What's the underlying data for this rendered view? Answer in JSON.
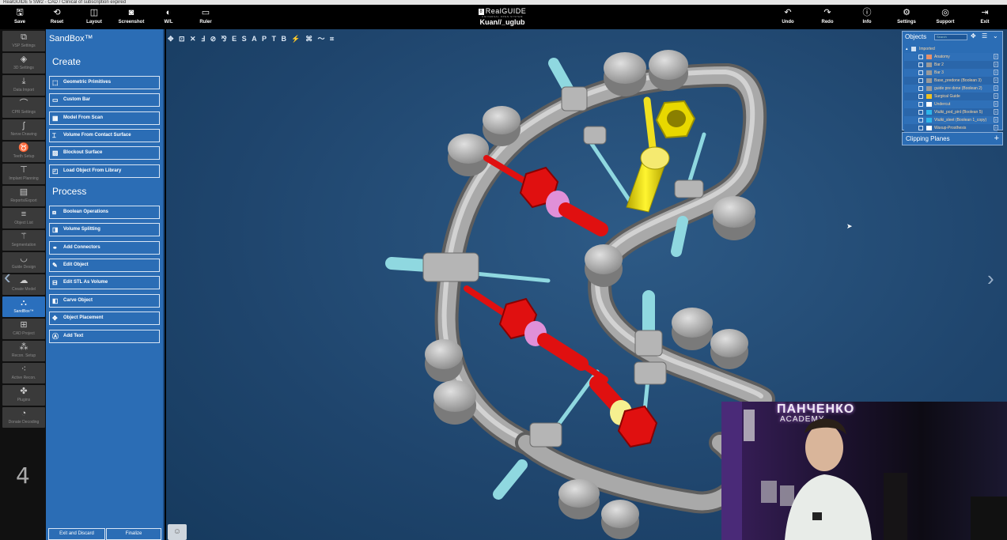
{
  "window": {
    "title": "RealGUIDE 5 SW2 - CAD / Clinical of subscription expired"
  },
  "toolbar": {
    "left": [
      {
        "icon": "save-icon",
        "label": "Save"
      },
      {
        "icon": "reset-icon",
        "label": "Reset"
      },
      {
        "icon": "layout-icon",
        "label": "Layout"
      },
      {
        "icon": "camera-icon",
        "label": "Screenshot"
      },
      {
        "icon": "contrast-icon",
        "label": "W/L"
      },
      {
        "icon": "ruler-icon",
        "label": "Ruler"
      }
    ],
    "right": [
      {
        "icon": "undo-icon",
        "label": "Undo"
      },
      {
        "icon": "redo-icon",
        "label": "Redo"
      },
      {
        "icon": "info-icon",
        "label": "Info"
      },
      {
        "icon": "gear-icon",
        "label": "Settings"
      },
      {
        "icon": "globe-icon",
        "label": "Support"
      },
      {
        "icon": "exit-icon",
        "label": "Exit"
      }
    ],
    "brand": "RealGUIDE",
    "brand_mark": "8",
    "brand_sub": "UNIVERSAL OPEN SYSTEM",
    "case_name": "Kuan//_uglub"
  },
  "rail": {
    "items": [
      {
        "label": "VSP Settings",
        "icon": "cube-icon"
      },
      {
        "label": "3D Settings",
        "icon": "settings-3d-icon"
      },
      {
        "label": "Data Import",
        "icon": "download-icon"
      },
      {
        "label": "CPR Settings",
        "icon": "curve-icon"
      },
      {
        "label": "Nerve Drawing",
        "icon": "nerve-icon"
      },
      {
        "label": "Teeth Setup",
        "icon": "tooth-icon"
      },
      {
        "label": "Implant Planning",
        "icon": "implant-icon"
      },
      {
        "label": "Reports/Export",
        "icon": "report-icon"
      },
      {
        "label": "Object List",
        "icon": "list-icon"
      },
      {
        "label": "Segmentation",
        "icon": "wand-icon"
      },
      {
        "label": "Guide Design",
        "icon": "guide-icon"
      },
      {
        "label": "Create Model",
        "icon": "model-icon"
      },
      {
        "label": "SandBox™",
        "icon": "sandbox-icon"
      },
      {
        "label": "CAD Project",
        "icon": "cad-icon"
      },
      {
        "label": "Recon. Setup",
        "icon": "recon-icon"
      },
      {
        "label": "Active Recon.",
        "icon": "active-recon-icon"
      },
      {
        "label": "Plugins",
        "icon": "puzzle-icon"
      },
      {
        "label": "Donate Decoding",
        "icon": "decode-icon"
      }
    ],
    "active_index": 12,
    "step_number": "4"
  },
  "panel": {
    "title": "SandBox™",
    "create_title": "Create",
    "create_items": [
      "Geometric Primitives",
      "Custom Bar",
      "Model From Scan",
      "Volume From Contact Surface",
      "Blockout Surface",
      "Load Object From Library"
    ],
    "process_title": "Process",
    "process_items": [
      "Boolean Operations",
      "Volume Splitting",
      "Add Connectors",
      "Edit Object",
      "Edit STL As Volume",
      "Carve Object",
      "Object Placement",
      "Add Text"
    ],
    "exit_label": "Exit and Discard",
    "finalize_label": "Finalize"
  },
  "viewport_tools": [
    "✥",
    "⊡",
    "✕",
    "Ⅎ",
    "⊘",
    "⅋",
    "E",
    "S",
    "A",
    "P",
    "T",
    "B",
    "⚡",
    "⌘",
    "〜",
    "⌗"
  ],
  "objects": {
    "title": "Objects",
    "search_placeholder": "Search",
    "group": "Imported",
    "items": [
      {
        "name": "Anatomy",
        "color": "#e8916a"
      },
      {
        "name": "Bar 2",
        "color": "#9a9a9a"
      },
      {
        "name": "Bar 3",
        "color": "#9a9a9a"
      },
      {
        "name": "Base_predone (Boolean 3)",
        "color": "#9a9a9a"
      },
      {
        "name": "guide pre done (Boolean 2)",
        "color": "#9a9a9a"
      },
      {
        "name": "Surgical Guide",
        "color": "#f0c020"
      },
      {
        "name": "Undercut",
        "color": "#ffffff"
      },
      {
        "name": "Vtulki_pod_pinl (Boolean 5)",
        "color": "#2eb5ea"
      },
      {
        "name": "Vtulki_sleet (Boolean 1_copy)",
        "color": "#2eb5ea"
      },
      {
        "name": "Waxup-Prosthesis",
        "color": "#ffffff"
      }
    ],
    "clipping_label": "Clipping Planes"
  },
  "webcam": {
    "sign_line1": "ПАНЧЕНКО",
    "sign_line2": "ACADEMY"
  },
  "colors": {
    "accent": "#2b6db5",
    "viewport_bg": "#1f456d",
    "bar": "#a0a0a0",
    "sleeve_red": "#e01010",
    "sleeve_yellow": "#f0e020",
    "pin": "#8fd8e0"
  }
}
